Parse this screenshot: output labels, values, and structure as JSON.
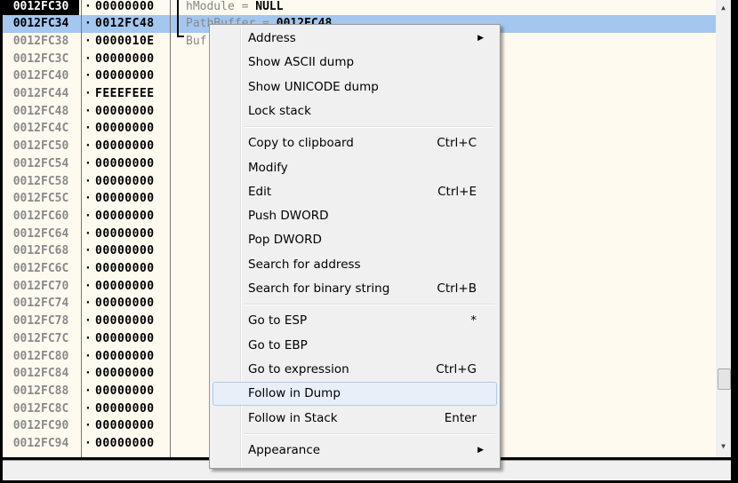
{
  "stack": {
    "rows": [
      {
        "address": "0012FC30",
        "value": "00000000",
        "comment": "hModule = ",
        "comment_value": "NULL",
        "state": "top"
      },
      {
        "address": "0012FC34",
        "value": "0012FC48",
        "comment": "PathBuffer = ",
        "comment_value": "0012FC48",
        "state": "selected"
      },
      {
        "address": "0012FC38",
        "value": "0000010E",
        "comment": "Buf",
        "comment_value": ""
      },
      {
        "address": "0012FC3C",
        "value": "00000000"
      },
      {
        "address": "0012FC40",
        "value": "00000000"
      },
      {
        "address": "0012FC44",
        "value": "FEEEFEEE"
      },
      {
        "address": "0012FC48",
        "value": "00000000"
      },
      {
        "address": "0012FC4C",
        "value": "00000000"
      },
      {
        "address": "0012FC50",
        "value": "00000000"
      },
      {
        "address": "0012FC54",
        "value": "00000000"
      },
      {
        "address": "0012FC58",
        "value": "00000000"
      },
      {
        "address": "0012FC5C",
        "value": "00000000"
      },
      {
        "address": "0012FC60",
        "value": "00000000"
      },
      {
        "address": "0012FC64",
        "value": "00000000"
      },
      {
        "address": "0012FC68",
        "value": "00000000"
      },
      {
        "address": "0012FC6C",
        "value": "00000000"
      },
      {
        "address": "0012FC70",
        "value": "00000000"
      },
      {
        "address": "0012FC74",
        "value": "00000000"
      },
      {
        "address": "0012FC78",
        "value": "00000000"
      },
      {
        "address": "0012FC7C",
        "value": "00000000"
      },
      {
        "address": "0012FC80",
        "value": "00000000"
      },
      {
        "address": "0012FC84",
        "value": "00000000"
      },
      {
        "address": "0012FC88",
        "value": "00000000"
      },
      {
        "address": "0012FC8C",
        "value": "00000000"
      },
      {
        "address": "0012FC90",
        "value": "00000000"
      },
      {
        "address": "0012FC94",
        "value": "00000000"
      }
    ]
  },
  "context_menu": {
    "items": [
      {
        "label": "Address",
        "shortcut": "",
        "submenu": true
      },
      {
        "label": "Show ASCII dump",
        "shortcut": ""
      },
      {
        "label": "Show UNICODE dump",
        "shortcut": ""
      },
      {
        "label": "Lock stack",
        "shortcut": ""
      },
      {
        "separator": true
      },
      {
        "label": "Copy to clipboard",
        "shortcut": "Ctrl+C"
      },
      {
        "label": "Modify",
        "shortcut": ""
      },
      {
        "label": "Edit",
        "shortcut": "Ctrl+E"
      },
      {
        "label": "Push DWORD",
        "shortcut": ""
      },
      {
        "label": "Pop DWORD",
        "shortcut": ""
      },
      {
        "label": "Search for address",
        "shortcut": ""
      },
      {
        "label": "Search for binary string",
        "shortcut": "Ctrl+B"
      },
      {
        "separator": true
      },
      {
        "label": "Go to ESP",
        "shortcut": "*"
      },
      {
        "label": "Go to EBP",
        "shortcut": ""
      },
      {
        "label": "Go to expression",
        "shortcut": "Ctrl+G"
      },
      {
        "label": "Follow in Dump",
        "shortcut": "",
        "highlighted": true
      },
      {
        "label": "Follow in Stack",
        "shortcut": "Enter"
      },
      {
        "separator": true
      },
      {
        "label": "Appearance",
        "shortcut": "",
        "submenu": true
      }
    ]
  },
  "colors": {
    "selection": "#a3c7ee",
    "background": "#fffaf0",
    "menu_highlight": "#e8eff8"
  }
}
